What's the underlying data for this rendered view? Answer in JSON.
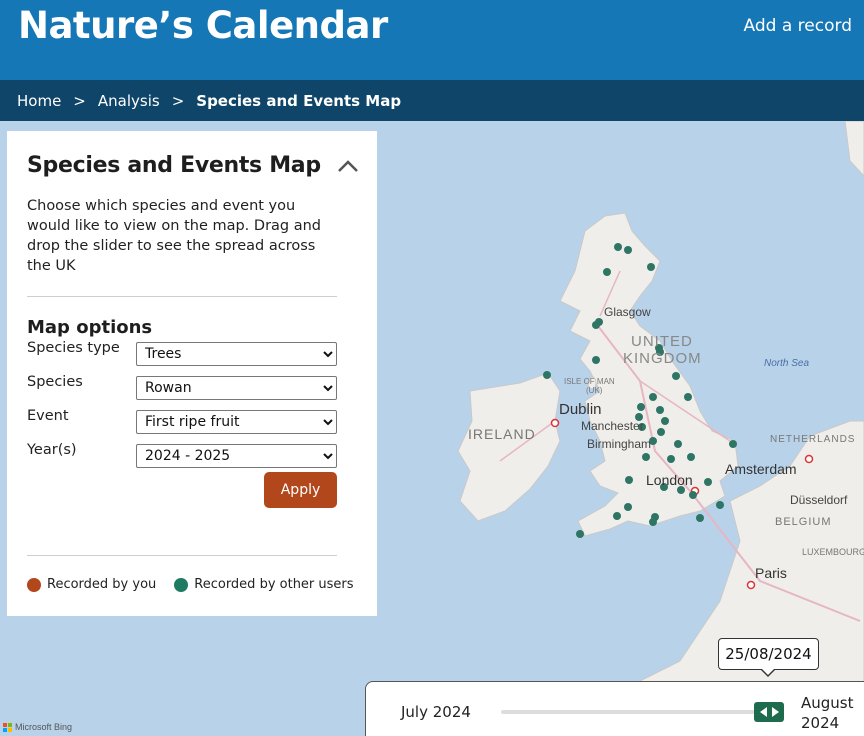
{
  "header": {
    "site_title": "Nature’s Calendar",
    "add_record": "Add a record",
    "bg_color": "#1577b6"
  },
  "breadcrumb": {
    "items": [
      "Home",
      "Analysis",
      "Species and Events Map"
    ],
    "separator": ">"
  },
  "panel": {
    "title": "Species and Events Map",
    "collapse_icon": "chevron-up-icon",
    "description": "Choose which species and event you would like to view on the map. Drag and drop the slider to see the spread across the UK",
    "options_heading": "Map options",
    "fields": [
      {
        "label": "Species type",
        "value": "Trees"
      },
      {
        "label": "Species",
        "value": "Rowan"
      },
      {
        "label": "Event",
        "value": "First ripe fruit"
      },
      {
        "label": "Year(s)",
        "value": "2024 - 2025"
      }
    ],
    "apply_label": "Apply",
    "apply_color": "#b1471b",
    "legend": [
      {
        "label": "Recorded by you",
        "color": "#b1471b"
      },
      {
        "label": "Recorded by other users",
        "color": "#1f7a62"
      }
    ]
  },
  "map": {
    "labels": {
      "glasgow": "Glasgow",
      "united": "UNITED",
      "kingdom": "KINGDOM",
      "north_sea": "North Sea",
      "isle_of_man": "ISLE OF MAN",
      "uk": "(UK)",
      "dublin": "Dublin",
      "manchester": "Manchester",
      "ireland": "IRELAND",
      "birmingham": "Birmingham",
      "netherlands": "NETHERLANDS",
      "amsterdam": "Amsterdam",
      "london": "London",
      "dusseldorf": "Düsseldorf",
      "belgium": "BELGIUM",
      "luxembourg": "LUXEMBOURG",
      "paris": "Paris"
    },
    "attribution": "Microsoft Bing",
    "point_color": "#2e7565"
  },
  "slider": {
    "start_label": "July 2024",
    "end_label_month": "August",
    "end_label_year": "2024",
    "current_date": "25/08/2024",
    "position_fraction": 0.94,
    "handle_color": "#1f6b4e"
  }
}
